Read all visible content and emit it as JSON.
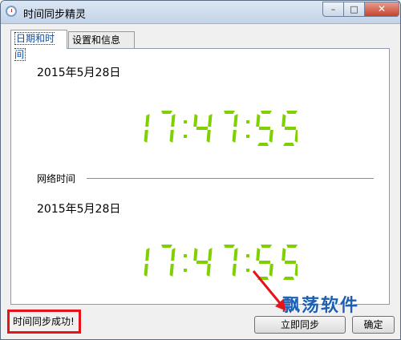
{
  "window": {
    "title": "时间同步精灵",
    "controls": {
      "minimize": "–",
      "maximize": "□",
      "close": "✕"
    }
  },
  "tabs": [
    {
      "label": "日期和时间",
      "active": true
    },
    {
      "label": "设置和信息",
      "active": false
    }
  ],
  "local": {
    "date": "2015年5月28日",
    "time": "17:47:55"
  },
  "network": {
    "label": "网络时间",
    "date": "2015年5月28日",
    "time": "17:47:55"
  },
  "status_text": "时间同步成功!",
  "buttons": {
    "sync": "立即同步",
    "ok": "确定"
  },
  "watermark": "飘荡软件",
  "colors": {
    "clock": "#7fd000",
    "highlight": "#e5141b",
    "watermark": "#1c5fb4"
  }
}
